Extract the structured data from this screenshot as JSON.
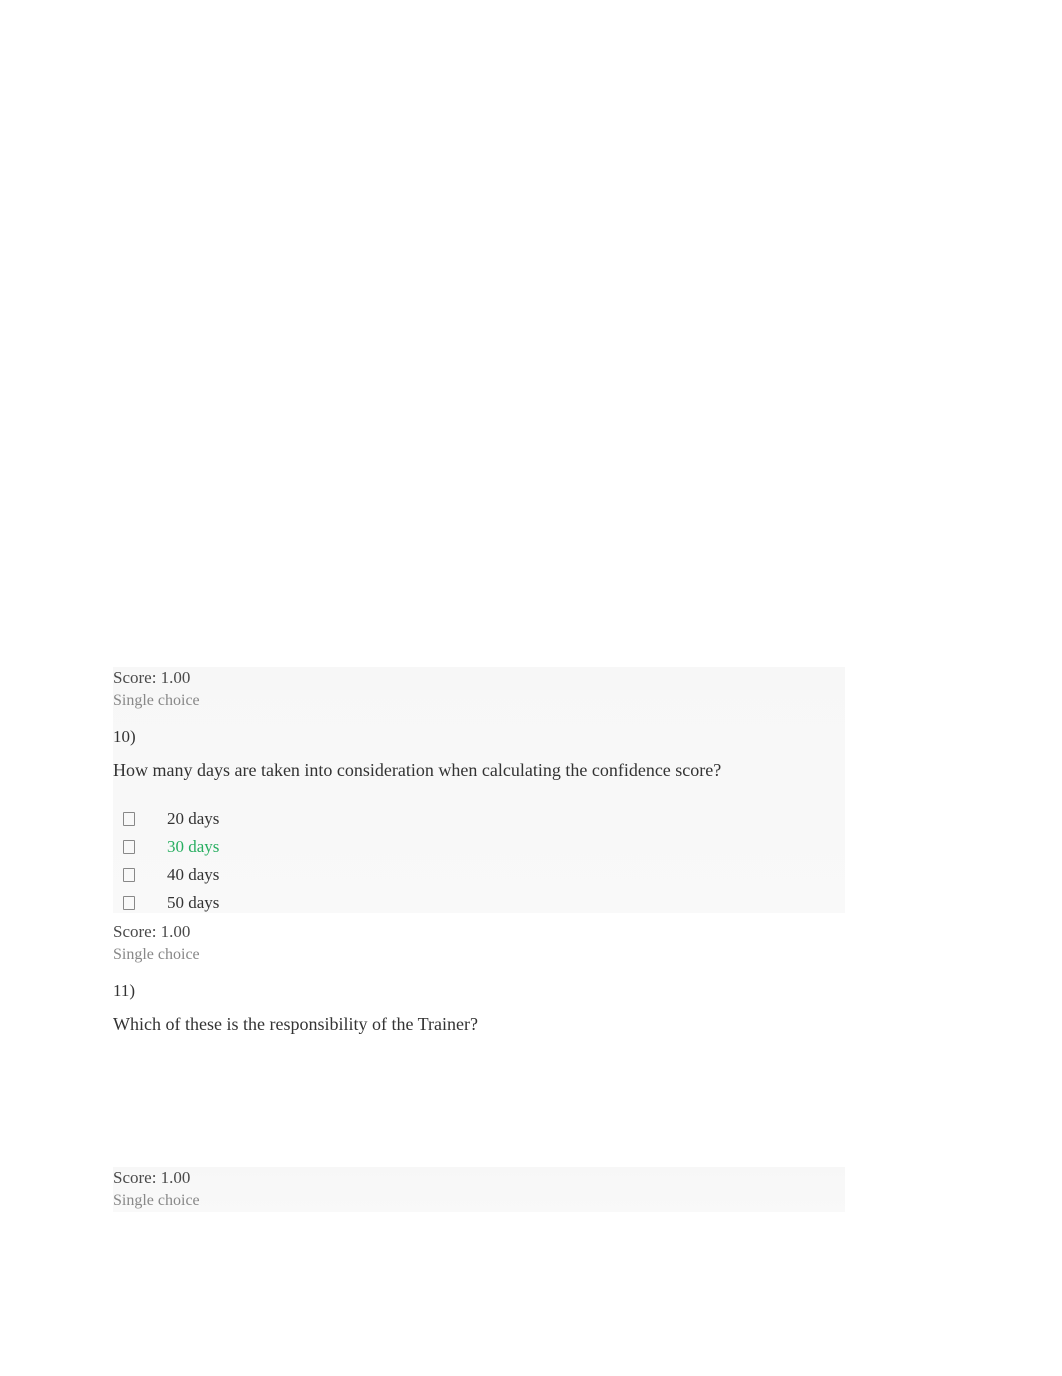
{
  "questions": [
    {
      "score": "Score: 1.00",
      "type": "Single choice",
      "number": "10)",
      "text": "How many days are taken into consideration when calculating the confidence score?",
      "options": [
        {
          "label": "20 days",
          "correct": false
        },
        {
          "label": "30 days",
          "correct": true
        },
        {
          "label": "40 days",
          "correct": false
        },
        {
          "label": "50 days",
          "correct": false
        }
      ]
    },
    {
      "score": "Score: 1.00",
      "type": "Single choice",
      "number": "11)",
      "text": "Which of these is the responsibility of the Trainer?",
      "options": []
    },
    {
      "score": "Score: 1.00",
      "type": "Single choice",
      "number": "",
      "text": "",
      "options": []
    }
  ]
}
